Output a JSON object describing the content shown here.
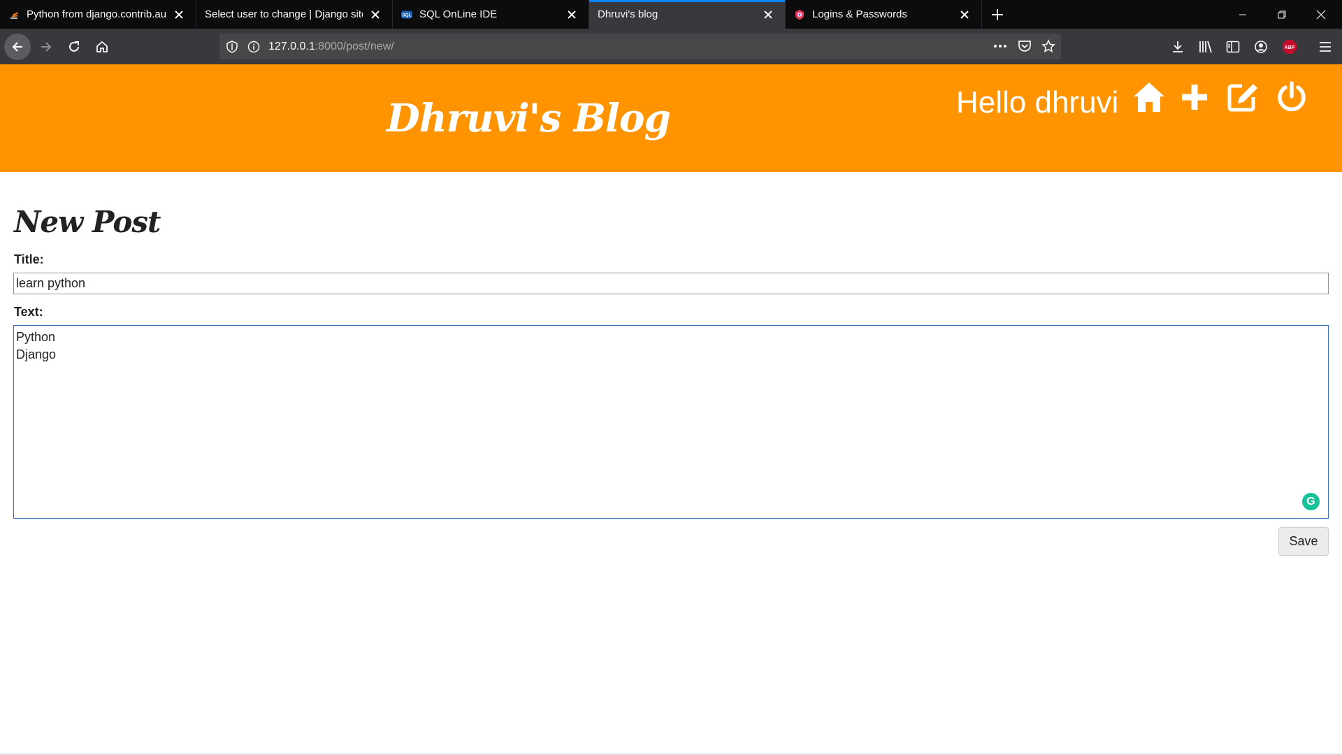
{
  "browser": {
    "tabs": [
      {
        "title": "Python from django.contrib.auth",
        "favicon": "stackoverflow-icon",
        "active": false
      },
      {
        "title": "Select user to change | Django site",
        "favicon": "none",
        "active": false
      },
      {
        "title": "SQL OnLine IDE",
        "favicon": "sql-icon",
        "active": false
      },
      {
        "title": "Dhruvi's blog",
        "favicon": "none",
        "active": true
      },
      {
        "title": "Logins & Passwords",
        "favicon": "lockwise-icon",
        "active": false
      }
    ],
    "url_host": "127.0.0.1",
    "url_path": ":8000/post/new/",
    "sql_badge": "SQL",
    "abp_badge": "ABP"
  },
  "header": {
    "blog_title": "Dhruvi's Blog",
    "greeting": "Hello dhruvi",
    "icons": [
      "home-icon",
      "plus-icon",
      "edit-icon",
      "power-icon"
    ],
    "background": "#ff9400"
  },
  "form": {
    "heading": "New Post",
    "title_label": "Title:",
    "title_value": "learn python",
    "text_label": "Text:",
    "text_value": "Python\nDjango",
    "save_label": "Save"
  },
  "grammarly_badge": "G"
}
